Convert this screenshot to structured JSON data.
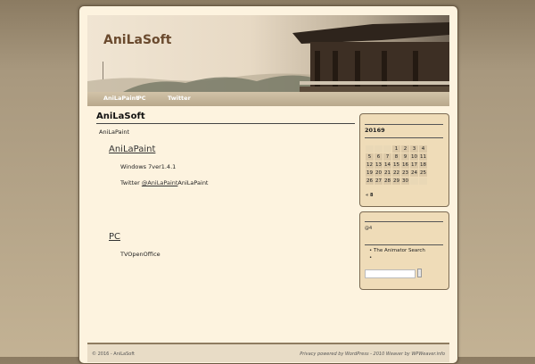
{
  "site": {
    "title": "AniLaSoft"
  },
  "nav": {
    "items": [
      "AniLaPaint",
      "PC",
      "Twitter"
    ]
  },
  "page": {
    "title": "AniLaSoft",
    "intro": "AniLaPaint",
    "section1": {
      "heading": "AniLaPaint",
      "line1": "Windows 7ver1.4.1",
      "line2_prefix": "Twitter ",
      "line2_link": "@AniLaPaint",
      "line2_suffix": "AniLaPaint"
    },
    "section2": {
      "heading": "PC",
      "line1": "TVOpenOffice"
    }
  },
  "calendar": {
    "caption": "20169",
    "rows": [
      [
        "",
        "",
        "",
        "1",
        "2",
        "3",
        "4"
      ],
      [
        "5",
        "6",
        "7",
        "8",
        "9",
        "10",
        "11"
      ],
      [
        "12",
        "13",
        "14",
        "15",
        "16",
        "17",
        "18"
      ],
      [
        "19",
        "20",
        "21",
        "22",
        "23",
        "24",
        "25"
      ],
      [
        "26",
        "27",
        "28",
        "29",
        "30",
        "",
        ""
      ]
    ],
    "prev": "« 8"
  },
  "widget2": {
    "label": "@4",
    "items": [
      "The Animator Search",
      ""
    ]
  },
  "footer": {
    "left": "© 2016 - AniLaSoft",
    "right": "Privacy powered by WordPress - 2010 Weaver by WPWeaver.info"
  }
}
